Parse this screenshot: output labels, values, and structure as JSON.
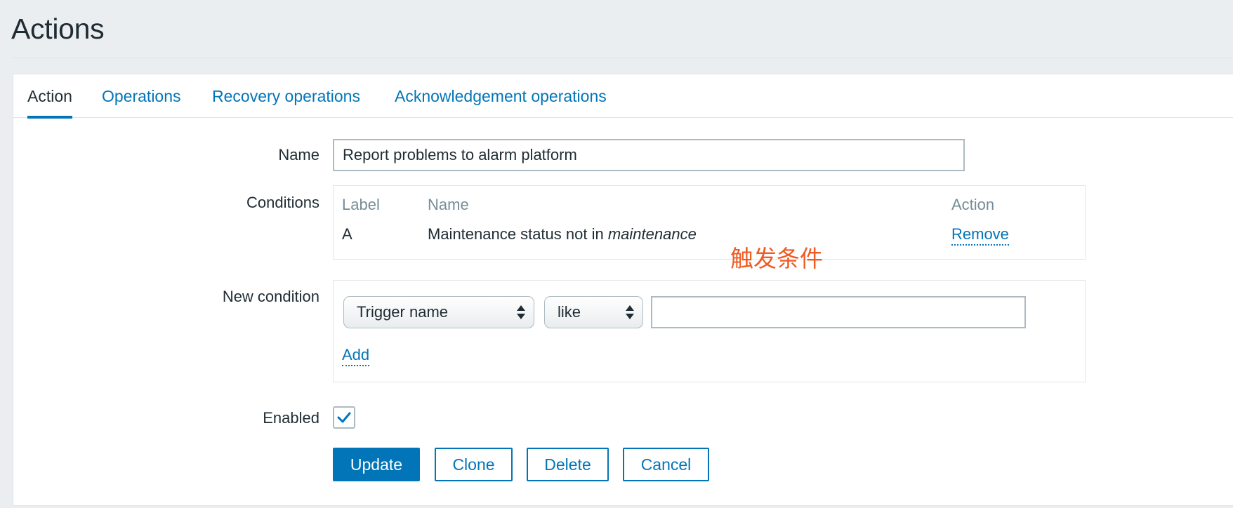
{
  "page": {
    "title": "Actions"
  },
  "tabs": [
    {
      "label": "Action",
      "active": true
    },
    {
      "label": "Operations",
      "active": false
    },
    {
      "label": "Recovery operations",
      "active": false
    },
    {
      "label": "Acknowledgement operations",
      "active": false
    }
  ],
  "form": {
    "name_label": "Name",
    "name_value": "Report problems to alarm platform",
    "conditions_label": "Conditions",
    "conditions": {
      "headers": {
        "label": "Label",
        "name": "Name",
        "action": "Action"
      },
      "rows": [
        {
          "label": "A",
          "name_prefix": "Maintenance status not in ",
          "name_emphasis": "maintenance",
          "action": "Remove"
        }
      ]
    },
    "annotation": "触发条件",
    "new_condition_label": "New condition",
    "new_condition": {
      "type_selected": "Trigger name",
      "operator_selected": "like",
      "value": "",
      "add_label": "Add"
    },
    "enabled_label": "Enabled",
    "enabled": true
  },
  "buttons": {
    "update": "Update",
    "clone": "Clone",
    "delete": "Delete",
    "cancel": "Cancel"
  },
  "colors": {
    "accent": "#0275b8",
    "annotation": "#f05a23",
    "background": "#ebeef0"
  }
}
